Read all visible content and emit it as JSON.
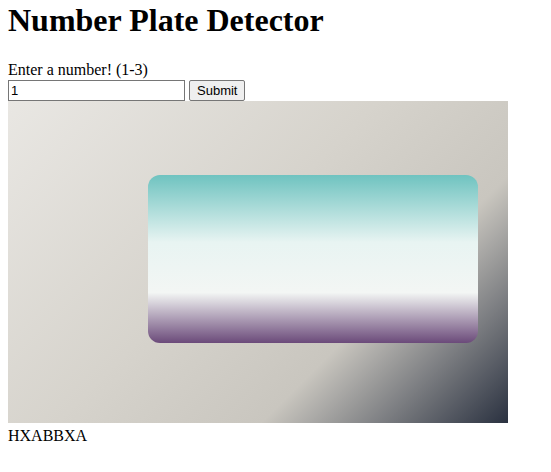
{
  "page": {
    "title": "Number Plate Detector"
  },
  "form": {
    "label": "Enter a number! (1-3)",
    "value": "1",
    "button": "Submit"
  },
  "result": {
    "text": "HXABBXA"
  }
}
